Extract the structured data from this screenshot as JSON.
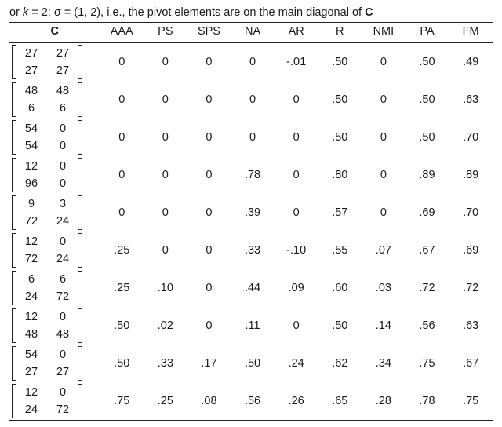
{
  "caption_html": "or <i>k</i> = 2; σ = (1, 2), i.e., the pivot elements are on the main diagonal of <b>C</b>",
  "header": {
    "c_label": "C",
    "metrics": [
      "AAA",
      "PS",
      "SPS",
      "NA",
      "AR",
      "R",
      "NMI",
      "PA",
      "FM"
    ]
  },
  "chart_data": {
    "type": "table",
    "columns": [
      "AAA",
      "PS",
      "SPS",
      "NA",
      "AR",
      "R",
      "NMI",
      "PA",
      "FM"
    ],
    "rows": [
      {
        "C": [
          [
            27,
            27
          ],
          [
            27,
            27
          ]
        ],
        "values": [
          "0",
          "0",
          "0",
          "0",
          "-.01",
          ".50",
          "0",
          ".50",
          ".49"
        ]
      },
      {
        "C": [
          [
            48,
            48
          ],
          [
            6,
            6
          ]
        ],
        "values": [
          "0",
          "0",
          "0",
          "0",
          "0",
          ".50",
          "0",
          ".50",
          ".63"
        ]
      },
      {
        "C": [
          [
            54,
            0
          ],
          [
            54,
            0
          ]
        ],
        "values": [
          "0",
          "0",
          "0",
          "0",
          "0",
          ".50",
          "0",
          ".50",
          ".70"
        ]
      },
      {
        "C": [
          [
            12,
            0
          ],
          [
            96,
            0
          ]
        ],
        "values": [
          "0",
          "0",
          "0",
          ".78",
          "0",
          ".80",
          "0",
          ".89",
          ".89"
        ]
      },
      {
        "C": [
          [
            9,
            3
          ],
          [
            72,
            24
          ]
        ],
        "values": [
          "0",
          "0",
          "0",
          ".39",
          "0",
          ".57",
          "0",
          ".69",
          ".70"
        ]
      },
      {
        "C": [
          [
            12,
            0
          ],
          [
            72,
            24
          ]
        ],
        "values": [
          ".25",
          "0",
          "0",
          ".33",
          "-.10",
          ".55",
          ".07",
          ".67",
          ".69"
        ]
      },
      {
        "C": [
          [
            6,
            6
          ],
          [
            24,
            72
          ]
        ],
        "values": [
          ".25",
          ".10",
          "0",
          ".44",
          ".09",
          ".60",
          ".03",
          ".72",
          ".72"
        ]
      },
      {
        "C": [
          [
            12,
            0
          ],
          [
            48,
            48
          ]
        ],
        "values": [
          ".50",
          ".02",
          "0",
          ".11",
          "0",
          ".50",
          ".14",
          ".56",
          ".63"
        ]
      },
      {
        "C": [
          [
            54,
            0
          ],
          [
            27,
            27
          ]
        ],
        "values": [
          ".50",
          ".33",
          ".17",
          ".50",
          ".24",
          ".62",
          ".34",
          ".75",
          ".67"
        ]
      },
      {
        "C": [
          [
            12,
            0
          ],
          [
            24,
            72
          ]
        ],
        "values": [
          ".75",
          ".25",
          ".08",
          ".56",
          ".26",
          ".65",
          ".28",
          ".78",
          ".75"
        ]
      }
    ]
  }
}
